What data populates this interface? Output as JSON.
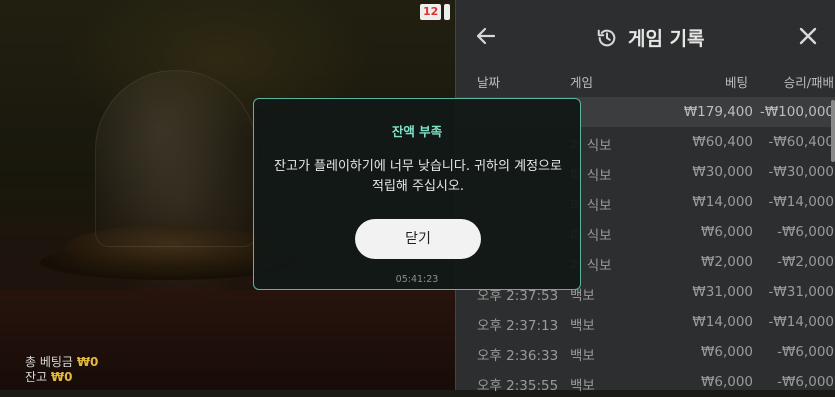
{
  "game": {
    "round_badges": [
      "12",
      ""
    ],
    "total_bet_label": "총 베팅금",
    "total_bet_value": "₩0",
    "balance_label": "잔고",
    "balance_value": "₩0"
  },
  "history": {
    "title": "게임 기록",
    "columns": {
      "date": "날짜",
      "game": "게임",
      "bet": "베팅",
      "result": "승리/패배"
    },
    "rows": [
      {
        "date": "",
        "game": "",
        "bet": "₩179,400",
        "result": "-₩100,000"
      },
      {
        "date": "",
        "game": "퍼 식보",
        "bet": "₩60,400",
        "result": "-₩60,400"
      },
      {
        "date": "",
        "game": "퍼 식보",
        "bet": "₩30,000",
        "result": "-₩30,000"
      },
      {
        "date": "",
        "game": "퍼 식보",
        "bet": "₩14,000",
        "result": "-₩14,000"
      },
      {
        "date": "",
        "game": "퍼 식보",
        "bet": "₩6,000",
        "result": "-₩6,000"
      },
      {
        "date": "",
        "game": "퍼 식보",
        "bet": "₩2,000",
        "result": "-₩2,000"
      },
      {
        "date": "오후 2:37:53",
        "game": "백보",
        "bet": "₩31,000",
        "result": "-₩31,000"
      },
      {
        "date": "오후 2:37:13",
        "game": "백보",
        "bet": "₩14,000",
        "result": "-₩14,000"
      },
      {
        "date": "오후 2:36:33",
        "game": "백보",
        "bet": "₩6,000",
        "result": "-₩6,000"
      },
      {
        "date": "오후 2:35:55",
        "game": "백보",
        "bet": "₩6,000",
        "result": "-₩6,000"
      }
    ]
  },
  "modal": {
    "title": "잔액 부족",
    "message": "잔고가 플레이하기에 너무 낮습니다. 귀하의 계정으로 적립해 주십시오.",
    "close_label": "닫기",
    "timestamp": "05:41:23"
  },
  "colors": {
    "accent": "#7fe0c8",
    "balance": "#e3b93c",
    "badge": "#d33333"
  }
}
